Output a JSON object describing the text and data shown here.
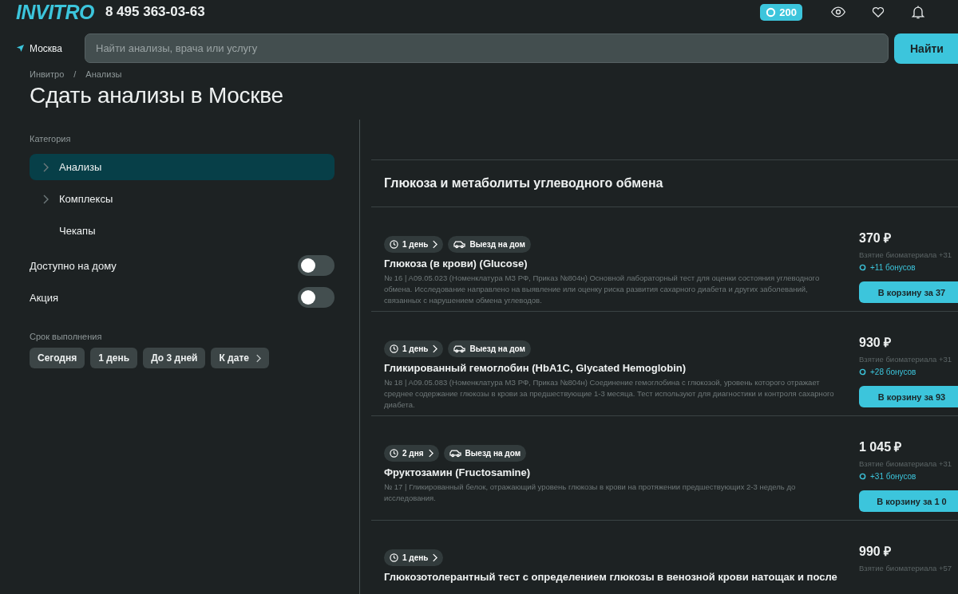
{
  "header": {
    "logo": "INVITRO",
    "phone": "8 495 363-03-63",
    "bonus_badge": "200"
  },
  "search": {
    "city": "Москва",
    "placeholder": "Найти анализы, врача или услугу",
    "button": "Найти"
  },
  "breadcrumbs": [
    "Инвитро",
    "/",
    "Анализы"
  ],
  "page_title": "Сдать анализы в Москве",
  "sidebar": {
    "category_label": "Категория",
    "categories": [
      {
        "label": "Анализы",
        "has_children": true,
        "selected": true
      },
      {
        "label": "Комплексы",
        "has_children": true,
        "selected": false
      },
      {
        "label": "Чекапы",
        "has_children": false,
        "selected": false
      }
    ],
    "toggles": [
      {
        "label": "Доступно на дому",
        "on": false
      },
      {
        "label": "Акция",
        "on": false
      }
    ],
    "deadline_label": "Срок выполнения",
    "deadline_chips": [
      {
        "label": "Сегодня",
        "kind": "plain"
      },
      {
        "label": "1 день",
        "kind": "plain"
      },
      {
        "label": "До 3 дней",
        "kind": "plain"
      },
      {
        "label": "К дате",
        "kind": "date"
      }
    ]
  },
  "section_title": "Глюкоза и метаболиты углеводного обмена",
  "tests": [
    {
      "tags": [
        {
          "kind": "duration",
          "label": "1 день"
        },
        {
          "kind": "home",
          "label": "Выезд на дом"
        }
      ],
      "title": "Глюкоза (в крови) (Glucose)",
      "description": "№ 16 | A09.05.023 (Номенклатура МЗ РФ, Приказ №804н) Основной лабораторный тест для оценки состояния углеводного обмена. Исследование направлено на выявление или оценку риска развития сахарного диабета и других заболеваний, связанных с нарушением обмена углеводов.",
      "price": "370 ₽",
      "note": "Взятие биоматериала +31",
      "bonus": "+11 бонусов",
      "cart_button": "В корзину за 37"
    },
    {
      "tags": [
        {
          "kind": "duration",
          "label": "1 день"
        },
        {
          "kind": "home",
          "label": "Выезд на дом"
        }
      ],
      "title": "Гликированный гемоглобин (HbA1C, Glycated Hemoglobin)",
      "description": "№ 18 | A09.05.083 (Номенклатура МЗ РФ, Приказ №804н) Соединение гемоглобина с глюкозой, уровень которого отражает среднее содержание глюкозы в крови за предшествующие 1-3 месяца. Тест используют для диагностики и контроля сахарного диабета.",
      "price": "930 ₽",
      "note": "Взятие биоматериала +31",
      "bonus": "+28 бонусов",
      "cart_button": "В корзину за 93"
    },
    {
      "tags": [
        {
          "kind": "duration",
          "label": "2 дня"
        },
        {
          "kind": "home",
          "label": "Выезд на дом"
        }
      ],
      "title": "Фруктозамин (Fructosamine)",
      "description": "№ 17 | Гликированный белок, отражающий уровень глюкозы в крови на протяжении предшествующих 2-3 недель до исследования.",
      "price": "1 045 ₽",
      "note": "Взятие биоматериала +31",
      "bonus": "+31 бонусов",
      "cart_button": "В корзину за 1 0"
    },
    {
      "tags": [
        {
          "kind": "duration",
          "label": "1 день"
        }
      ],
      "title": "Глюкозотолерантный тест с определением глюкозы в венозной крови натощак и после",
      "price": "990 ₽",
      "note": "Взятие биоматериала +57"
    }
  ]
}
